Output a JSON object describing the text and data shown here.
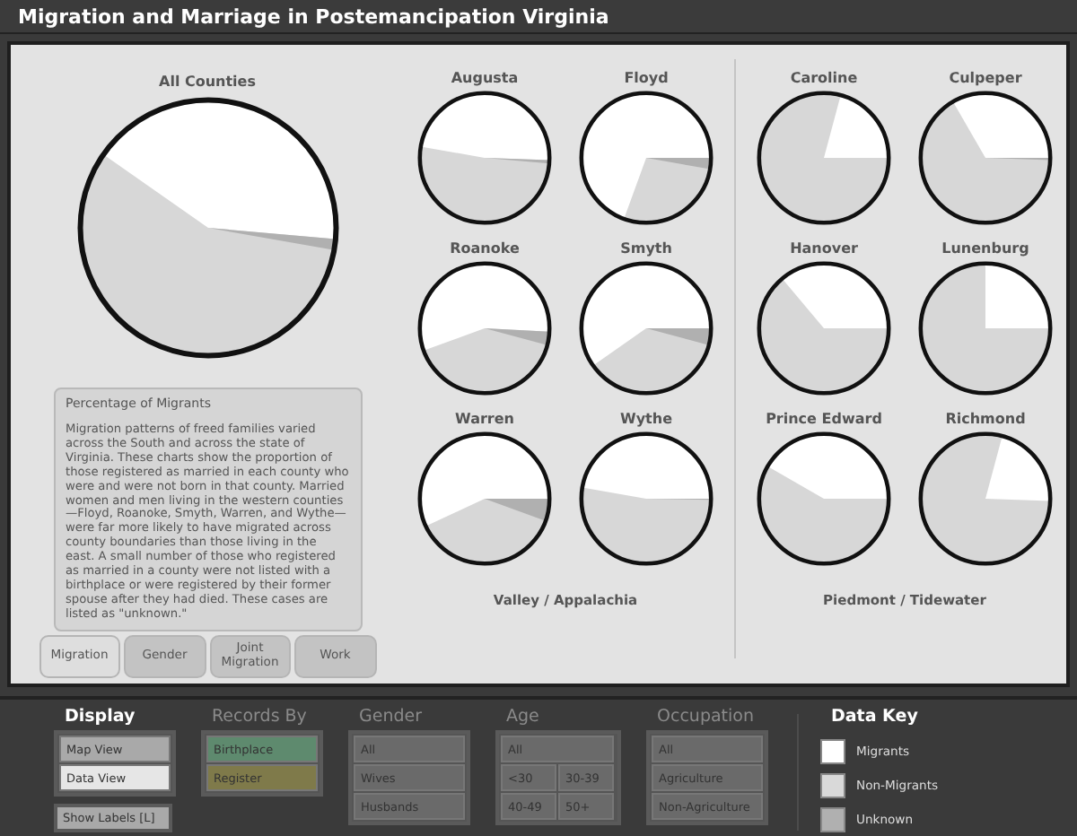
{
  "window": {
    "title": "Migration and Marriage in Postemancipation Virginia"
  },
  "charts": {
    "main": {
      "name": "All Counties"
    },
    "description": {
      "heading": "Percentage of Migrants",
      "body": "Migration patterns of freed families varied across the South and across the state of Virginia. These charts show the proportion of those registered as married in each county who were and were not born in that county. Married women and men living in the western counties—Floyd, Roanoke, Smyth, Warren, and Wythe—were far more likely to have migrated across county boundaries than those living in the east.  A small number of those who registered as married in a county were not listed with a birthplace or were registered by their former spouse after they had died. These cases are listed as \"unknown.\""
    },
    "tabs": [
      {
        "label": "Migration",
        "selected": true
      },
      {
        "label": "Gender",
        "selected": false
      },
      {
        "label": "Joint Migration",
        "selected": false
      },
      {
        "label": "Work",
        "selected": false
      }
    ],
    "regions": [
      {
        "label": "Valley / Appalachia",
        "counties": [
          {
            "name": "Augusta"
          },
          {
            "name": "Floyd"
          },
          {
            "name": "Roanoke"
          },
          {
            "name": "Smyth"
          },
          {
            "name": "Warren"
          },
          {
            "name": "Wythe"
          }
        ]
      },
      {
        "label": "Piedmont / Tidewater",
        "counties": [
          {
            "name": "Caroline"
          },
          {
            "name": "Culpeper"
          },
          {
            "name": "Hanover"
          },
          {
            "name": "Lunenburg"
          },
          {
            "name": "Prince Edward"
          },
          {
            "name": "Richmond"
          }
        ]
      }
    ]
  },
  "controls": {
    "display": {
      "title": "Display",
      "options": [
        {
          "label": "Map View",
          "selected": false
        },
        {
          "label": "Data View",
          "selected": true
        }
      ],
      "labels_button": "Show Labels [L]"
    },
    "filters": [
      {
        "kind": "list",
        "title": "Records By",
        "disabled": true,
        "options": [
          {
            "label": "Birthplace",
            "color": "#5e8a6e"
          },
          {
            "label": "Register",
            "color": "#7f7a4a"
          }
        ]
      },
      {
        "kind": "list",
        "title": "Gender",
        "disabled": true,
        "options": [
          {
            "label": "All"
          },
          {
            "label": "Wives"
          },
          {
            "label": "Husbands"
          }
        ]
      },
      {
        "kind": "grid",
        "title": "Age",
        "disabled": true,
        "options": [
          {
            "label": "All"
          },
          {
            "label": "<30"
          },
          {
            "label": "30-39"
          },
          {
            "label": "40-49"
          },
          {
            "label": "50+"
          }
        ]
      },
      {
        "kind": "list",
        "title": "Occupation",
        "disabled": true,
        "options": [
          {
            "label": "All"
          },
          {
            "label": "Agriculture"
          },
          {
            "label": "Non-Agriculture"
          }
        ]
      }
    ],
    "data_key": {
      "title": "Data Key",
      "items": [
        {
          "label": "Migrants",
          "color": "#ffffff"
        },
        {
          "label": "Non-Migrants",
          "color": "#d9d9d9"
        },
        {
          "label": "Unknown",
          "color": "#b0b0b0"
        }
      ]
    }
  }
}
